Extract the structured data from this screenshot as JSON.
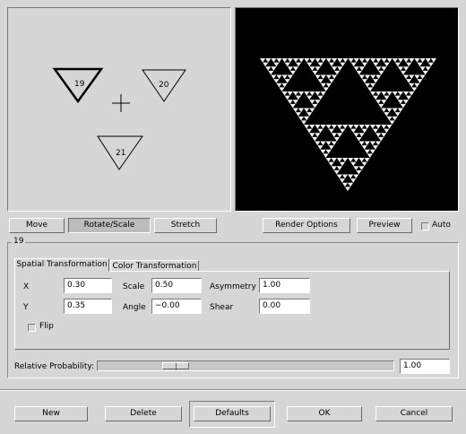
{
  "design_panel": {
    "triangles": [
      {
        "id": "19",
        "selected": true
      },
      {
        "id": "20",
        "selected": false
      },
      {
        "id": "21",
        "selected": false
      }
    ]
  },
  "mode_buttons": {
    "move": "Move",
    "rotate_scale": "Rotate/Scale",
    "stretch": "Stretch",
    "active": "rotate_scale"
  },
  "render_buttons": {
    "render_options": "Render Options",
    "preview": "Preview",
    "auto_label": "Auto",
    "auto_checked": false
  },
  "transform": {
    "group_title": "19",
    "tabs": {
      "spatial": "Spatial Transformation",
      "color": "Color Transformation",
      "active": "spatial"
    },
    "labels": {
      "x": "X",
      "y": "Y",
      "scale": "Scale",
      "angle": "Angle",
      "asymmetry": "Asymmetry",
      "shear": "Shear",
      "flip": "Flip"
    },
    "values": {
      "x": "0.30",
      "y": "0.35",
      "scale": "0.50",
      "angle": "−0.00",
      "asymmetry": "1.00",
      "shear": "0.00"
    },
    "flip_checked": false
  },
  "probability": {
    "label": "Relative Probability:",
    "value": "1.00",
    "slider_fraction": 0.24
  },
  "dialog_buttons": {
    "new": "New",
    "delete": "Delete",
    "defaults": "Defaults",
    "ok": "OK",
    "cancel": "Cancel"
  }
}
